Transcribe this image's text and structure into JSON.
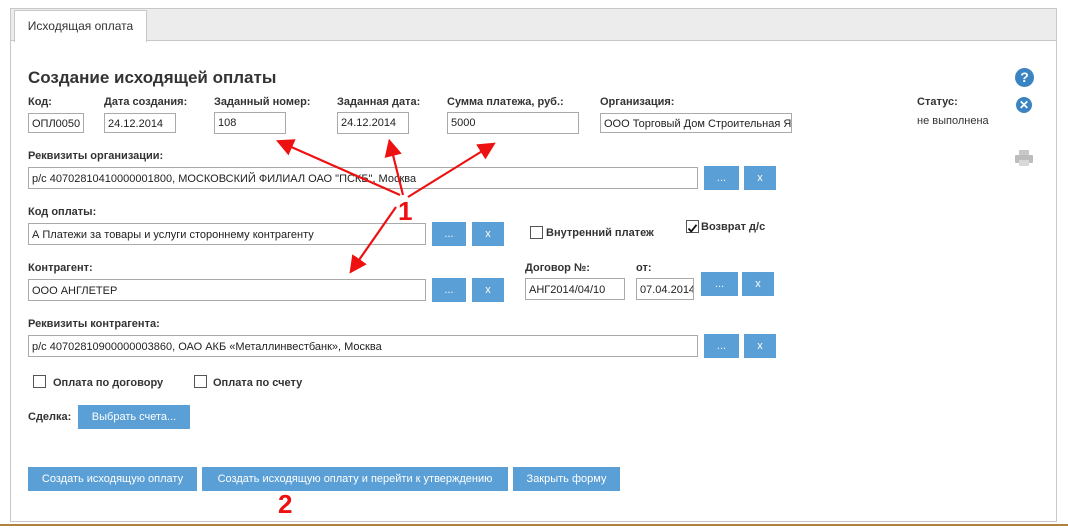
{
  "tabs": [
    {
      "label": "Исходящая оплата"
    }
  ],
  "form": {
    "title": "Создание исходящей оплаты",
    "code": {
      "label": "Код:",
      "value": "ОПЛ0050"
    },
    "created": {
      "label": "Дата создания:",
      "value": "24.12.2014"
    },
    "given_number": {
      "label": "Заданный номер:",
      "value": "108"
    },
    "given_date": {
      "label": "Заданная дата:",
      "value": "24.12.2014"
    },
    "amount": {
      "label": "Сумма платежа, руб.:",
      "value": "5000"
    },
    "organization": {
      "label": "Организация:",
      "value": "ООО Торговый Дом Строительная Я"
    },
    "status": {
      "label": "Статус:",
      "value": "не выполнена"
    },
    "org_requisites": {
      "label": "Реквизиты организации:",
      "value": "р/с 40702810410000001800, МОСКОВСКИЙ ФИЛИАЛ ОАО \"ПСКБ\", Москва"
    },
    "payment_code": {
      "label": "Код оплаты:",
      "value": "А Платежи за товары и услуги стороннему контрагенту"
    },
    "internal_payment": {
      "label": "Внутренний платеж",
      "checked": false
    },
    "refund": {
      "label": "Возврат д/с",
      "checked": true
    },
    "counterparty": {
      "label": "Контрагент:",
      "value": "ООО АНГЛЕТЕР"
    },
    "contract_no": {
      "label": "Договор №:",
      "value": "АНГ2014/04/10"
    },
    "contract_date": {
      "label": "от:",
      "value": "07.04.2014"
    },
    "cp_requisites": {
      "label": "Реквизиты контрагента:",
      "value": "р/с 40702810900000003860, ОАО АКБ «Металлинвестбанк», Москва"
    },
    "pay_by_contract": {
      "label": "Оплата по договору",
      "checked": false
    },
    "pay_by_invoice": {
      "label": "Оплата по счету",
      "checked": false
    },
    "deal": {
      "label": "Сделка:",
      "button": "Выбрать счета..."
    }
  },
  "buttons": {
    "browse": "...",
    "clear": "x",
    "create": "Создать исходящую оплату",
    "create_approve": "Создать исходящую оплату и перейти к утверждению",
    "close": "Закрыть форму"
  },
  "annotations": {
    "one": "1",
    "two": "2"
  },
  "icons": [
    "help-icon",
    "close-icon",
    "print-icon",
    "checkmark-icon"
  ],
  "colors": {
    "accent": "#5a9fd6",
    "annotation": "#ee1111",
    "icon": "#3b84c4"
  }
}
